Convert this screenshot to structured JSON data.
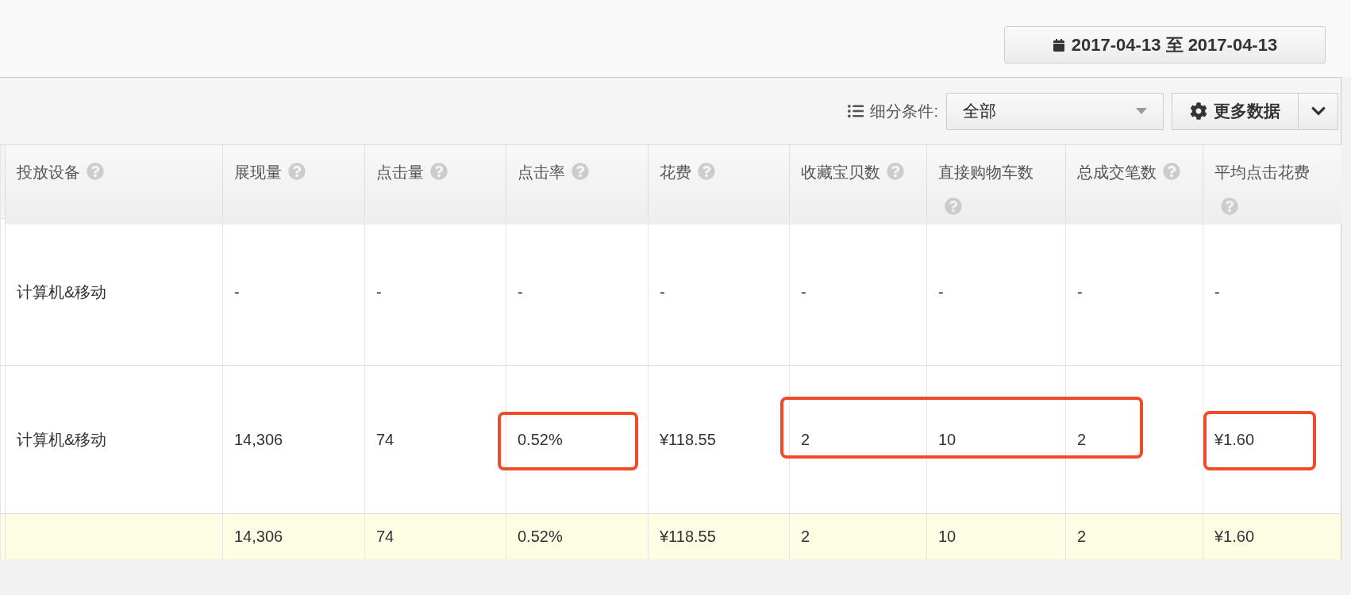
{
  "date_range": {
    "start": "2017-04-13",
    "separator": "至",
    "end": "2017-04-13"
  },
  "toolbar": {
    "filter_label": "细分条件:",
    "filter_value": "全部",
    "more_button": "更多数据"
  },
  "table": {
    "columns": [
      {
        "label": "投放设备"
      },
      {
        "label": "展现量"
      },
      {
        "label": "点击量"
      },
      {
        "label": "点击率"
      },
      {
        "label": "花费"
      },
      {
        "label": "收藏宝贝数"
      },
      {
        "label": "直接购物车数"
      },
      {
        "label": "总成交笔数"
      },
      {
        "label": "平均点击花费"
      }
    ],
    "rows": [
      {
        "cells": [
          "计算机&移动",
          "-",
          "-",
          "-",
          "-",
          "-",
          "-",
          "-",
          "-"
        ]
      },
      {
        "cells": [
          "计算机&移动",
          "14,306",
          "74",
          "0.52%",
          "¥118.55",
          "2",
          "10",
          "2",
          "¥1.60"
        ]
      }
    ],
    "totals": {
      "cells": [
        "14,306",
        "74",
        "0.52%",
        "¥118.55",
        "2",
        "10",
        "2",
        "¥1.60"
      ]
    }
  }
}
